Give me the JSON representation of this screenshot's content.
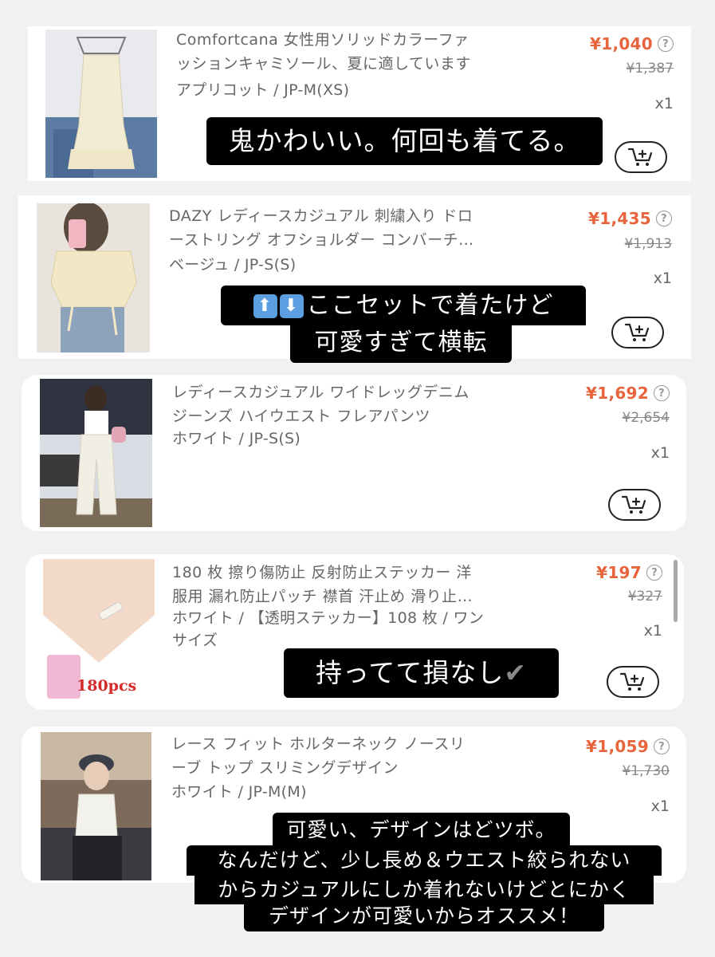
{
  "colors": {
    "price": "#e8643c",
    "text": "#666666",
    "caption_bg": "#000000"
  },
  "items": [
    {
      "title": "Comfortcana 女性用ソリッドカラーファッションキャミソール、夏に適しています",
      "title_line1": "Comfortcana 女性用ソリッドカラーファ",
      "title_line2": "ッションキャミソール、夏に適しています",
      "variant": "アプリコット / JP-M(XS)",
      "price": "¥1,040",
      "original_price": "¥1,387",
      "qty": "x1",
      "caption": "鬼かわいい。何回も着てる。"
    },
    {
      "title_line1": "DAZY レディースカジュアル 刺繍入り ドロ",
      "title_line2": "ーストリング オフショルダー コンバーチ…",
      "variant": "ベージュ / JP-S(S)",
      "price": "¥1,435",
      "original_price": "¥1,913",
      "qty": "x1",
      "caption_line1": "ここセットで着たけど",
      "caption_line2": "可愛すぎて横転",
      "caption_icons": [
        "up-arrow-icon",
        "down-arrow-icon"
      ]
    },
    {
      "title_line1": "レディースカジュアル ワイドレッグデニム",
      "title_line2": "ジーンズ ハイウエスト フレアパンツ",
      "variant": "ホワイト / JP-S(S)",
      "price": "¥1,692",
      "original_price": "¥2,654",
      "qty": "x1"
    },
    {
      "title_line1": "180 枚 擦り傷防止 反射防止ステッカー 洋",
      "title_line2": "服用 漏れ防止パッチ 襟首 汗止め 滑り止…",
      "variant_line1": "ホワイト / 【透明ステッカー】108 枚 / ワン",
      "variant_line2": "サイズ",
      "price": "¥197",
      "original_price": "¥327",
      "qty": "x1",
      "image_label": "180pcs",
      "caption": "持ってて損なし",
      "caption_icon": "check-mark-icon"
    },
    {
      "title_line1": "レース フィット ホルターネック ノースリ",
      "title_line2": "ーブ トップ スリミングデザイン",
      "variant": "ホワイト / JP-M(M)",
      "price": "¥1,059",
      "original_price": "¥1,730",
      "qty": "x1",
      "caption_lines": [
        "可愛い、デザインはどツボ。",
        "なんだけど、少し長め＆ウエスト絞られない",
        "からカジュアルにしか着れないけどとにかく",
        "デザインが可愛いからオススメ！"
      ]
    }
  ]
}
